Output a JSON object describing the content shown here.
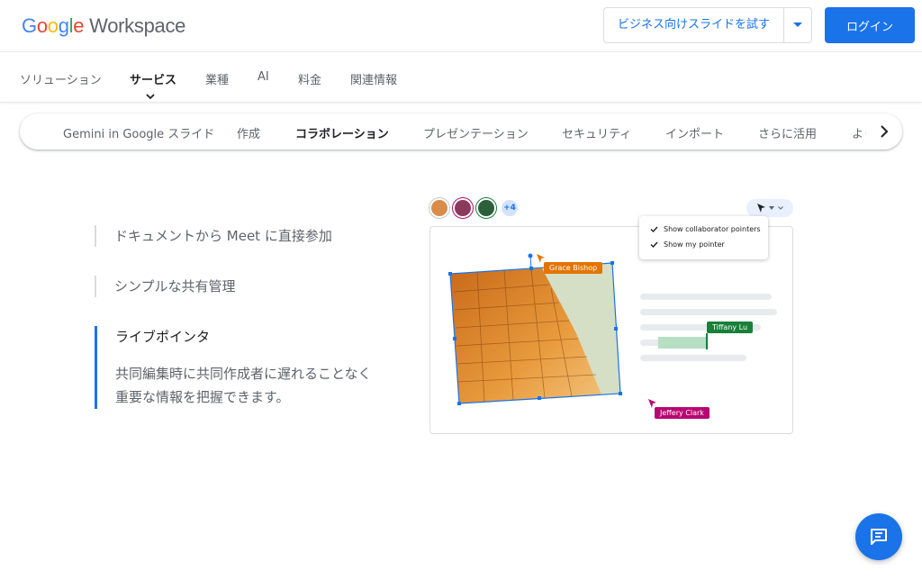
{
  "header": {
    "logo_google": [
      "G",
      "o",
      "o",
      "g",
      "l",
      "e"
    ],
    "logo_workspace": "Workspace",
    "try_button": "ビジネス向けスライドを試す",
    "login_button": "ログイン"
  },
  "main_nav": {
    "items": [
      "ソリューション",
      "サービス",
      "業種",
      "AI",
      "料金",
      "関連情報"
    ],
    "active": "サービス"
  },
  "sub_nav": {
    "items": [
      "Gemini in Google スライド",
      "作成",
      "コラボレーション",
      "プレゼンテーション",
      "セキュリティ",
      "インポート",
      "さらに活用",
      "よくある"
    ],
    "active": "コラボレーション"
  },
  "features": [
    {
      "title": "ドキュメントから Meet に直接参加"
    },
    {
      "title": "シンプルな共有管理"
    },
    {
      "title": "ライブポインタ",
      "description": "共同編集時に共同作成者に遅れることなく重要な情報を把握できます。"
    }
  ],
  "illustration": {
    "more_collaborators": "+4",
    "menu_items": [
      "Show collaborator pointers",
      "Show my pointer"
    ],
    "pointers": {
      "grace": {
        "name": "Grace Bishop",
        "color": "#e37400"
      },
      "tiffany": {
        "name": "Tiffany Lu",
        "color": "#188038"
      },
      "jeffery": {
        "name": "Jeffery Clark",
        "color": "#b80672"
      }
    }
  },
  "colors": {
    "accent": "#1a73e8"
  },
  "icons": {
    "fab": "chat-feedback-icon",
    "subnav_next": "chevron-right-icon",
    "nav_active": "chevron-down-icon"
  }
}
